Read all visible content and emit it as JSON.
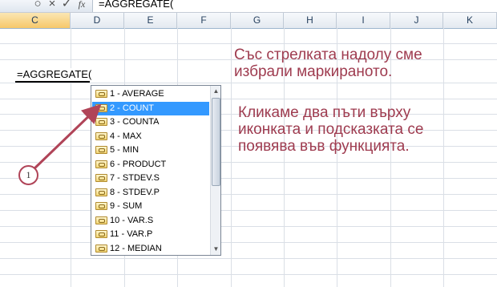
{
  "formula_bar": {
    "cancel_icon": "close-icon",
    "enter_icon": "checkmark-icon",
    "fx_label": "fx",
    "content": "=AGGREGATE("
  },
  "columns": [
    "C",
    "D",
    "E",
    "F",
    "G",
    "H",
    "I",
    "J",
    "K"
  ],
  "selected_column": "C",
  "active_cell": {
    "text": "=AGGREGATE("
  },
  "autocomplete": {
    "items": [
      {
        "label": "1 - AVERAGE",
        "icon": "function-icon"
      },
      {
        "label": "2 - COUNT",
        "icon": "function-icon",
        "selected": true
      },
      {
        "label": "3 - COUNTA",
        "icon": "function-icon"
      },
      {
        "label": "4 - MAX",
        "icon": "function-icon"
      },
      {
        "label": "5 - MIN",
        "icon": "function-icon"
      },
      {
        "label": "6 - PRODUCT",
        "icon": "function-icon"
      },
      {
        "label": "7 - STDEV.S",
        "icon": "function-icon"
      },
      {
        "label": "8 - STDEV.P",
        "icon": "function-icon"
      },
      {
        "label": "9 - SUM",
        "icon": "function-icon"
      },
      {
        "label": "10 - VAR.S",
        "icon": "function-icon"
      },
      {
        "label": "11 - VAR.P",
        "icon": "function-icon"
      },
      {
        "label": "12 - MEDIAN",
        "icon": "function-icon"
      }
    ]
  },
  "annotations": {
    "note1_line1": "Със стрелката надолу сме",
    "note1_line2": "избрали маркираното.",
    "note2_line1": "Кликаме два пъти върху",
    "note2_line2": "иконката и подсказката се",
    "note2_line3": "появява във функцията.",
    "badge_number": "1",
    "accent_color": "#9e3b4f"
  }
}
